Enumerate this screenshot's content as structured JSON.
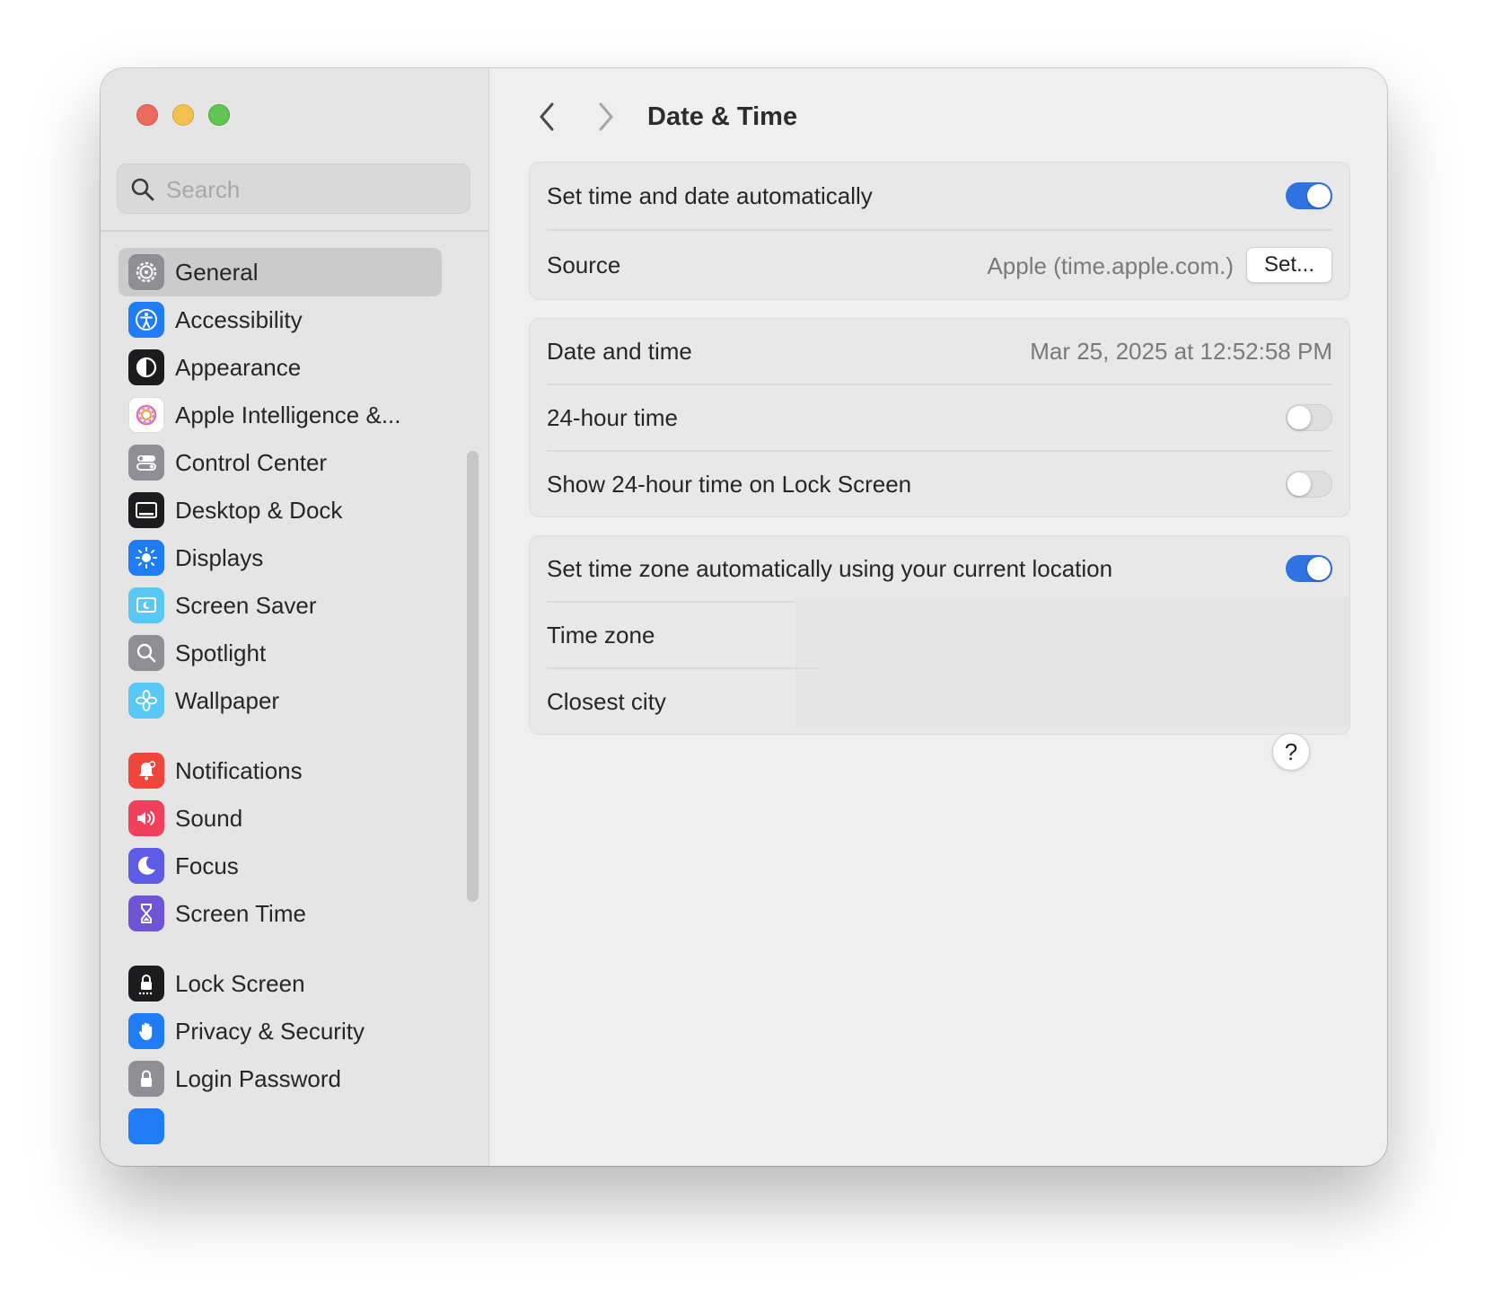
{
  "search": {
    "placeholder": "Search"
  },
  "sidebar": {
    "items": [
      {
        "label": "General",
        "icon": "gear-icon",
        "color": "#8e8e93",
        "selected": true
      },
      {
        "label": "Accessibility",
        "icon": "accessibility-icon",
        "color": "#1f7cf5"
      },
      {
        "label": "Appearance",
        "icon": "appearance-icon",
        "color": "#1c1c1e"
      },
      {
        "label": "Apple Intelligence &...",
        "icon": "apple-intelligence-icon",
        "color": "#e86fa8"
      },
      {
        "label": "Control Center",
        "icon": "control-center-icon",
        "color": "#8e8e93"
      },
      {
        "label": "Desktop & Dock",
        "icon": "desktop-dock-icon",
        "color": "#1c1c1e"
      },
      {
        "label": "Displays",
        "icon": "displays-icon",
        "color": "#1f7cf5"
      },
      {
        "label": "Screen Saver",
        "icon": "screen-saver-icon",
        "color": "#5ac8f5"
      },
      {
        "label": "Spotlight",
        "icon": "spotlight-icon",
        "color": "#8e8e93"
      },
      {
        "label": "Wallpaper",
        "icon": "wallpaper-icon",
        "color": "#5ac8f5"
      },
      {
        "label": "Notifications",
        "icon": "notifications-icon",
        "color": "#f0453a"
      },
      {
        "label": "Sound",
        "icon": "sound-icon",
        "color": "#f0405c"
      },
      {
        "label": "Focus",
        "icon": "focus-icon",
        "color": "#5e5ce6"
      },
      {
        "label": "Screen Time",
        "icon": "screen-time-icon",
        "color": "#6e55d6"
      },
      {
        "label": "Lock Screen",
        "icon": "lock-screen-icon",
        "color": "#1c1c1e"
      },
      {
        "label": "Privacy & Security",
        "icon": "privacy-hand-icon",
        "color": "#1f7cf5"
      },
      {
        "label": "Login Password",
        "icon": "login-password-icon",
        "color": "#8e8e93"
      }
    ]
  },
  "header": {
    "title": "Date & Time"
  },
  "groups": {
    "auto": {
      "set_auto_label": "Set time and date automatically",
      "set_auto_on": true,
      "source_label": "Source",
      "source_value": "Apple (time.apple.com.)",
      "set_button": "Set..."
    },
    "datetime": {
      "date_label": "Date and time",
      "date_value": "Mar 25, 2025 at 12:52:58 PM",
      "h24_label": "24-hour time",
      "h24_on": false,
      "lock_label": "Show 24-hour time on Lock Screen",
      "lock_on": false
    },
    "timezone": {
      "auto_tz_label": "Set time zone automatically using your current location",
      "auto_tz_on": true,
      "tz_label": "Time zone",
      "city_label": "Closest city"
    }
  },
  "help": {
    "label": "?"
  },
  "colors": {
    "accent": "#2f73e3",
    "window_bg": "#efefef",
    "sidebar_bg": "#e5e5e5"
  }
}
